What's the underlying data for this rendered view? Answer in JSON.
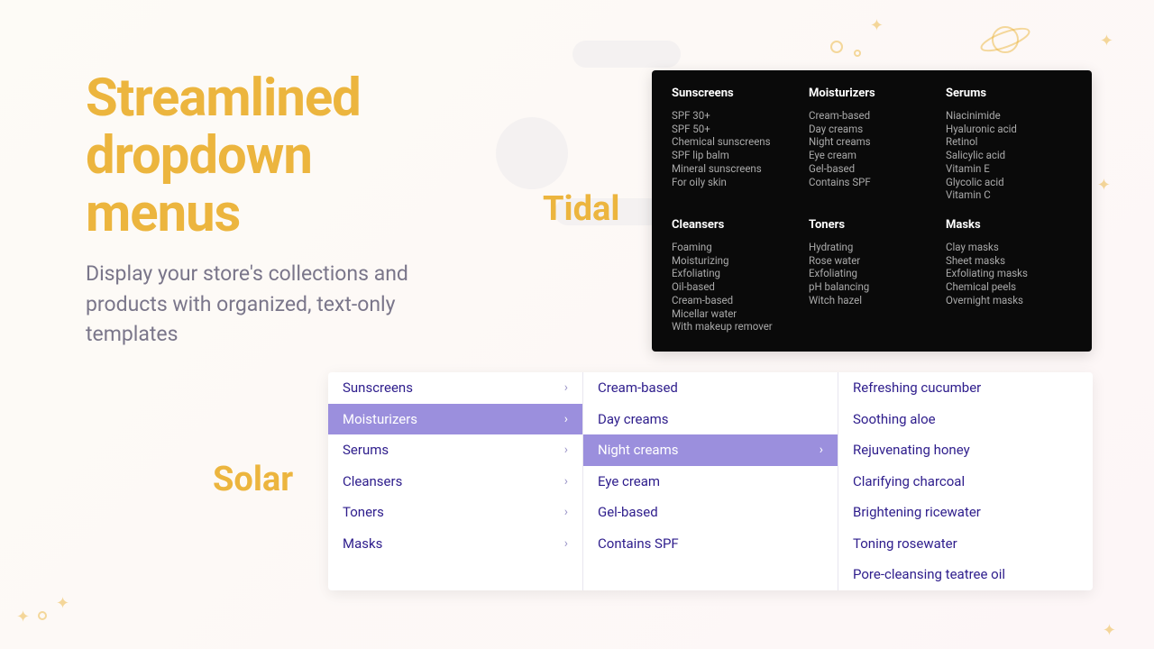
{
  "hero": {
    "title": "Streamlined dropdown menus",
    "subtitle": "Display your store's collections and products with organized, text-only templates"
  },
  "labels": {
    "tidal": "Tidal",
    "solar": "Solar"
  },
  "tidal": {
    "columns": [
      {
        "heading": "Sunscreens",
        "items": [
          "SPF 30+",
          "SPF 50+",
          "Chemical sunscreens",
          "SPF lip balm",
          "Mineral sunscreens",
          "For oily skin"
        ]
      },
      {
        "heading": "Moisturizers",
        "items": [
          "Cream-based",
          "Day creams",
          "Night creams",
          "Eye cream",
          "Gel-based",
          "Contains SPF"
        ]
      },
      {
        "heading": "Serums",
        "items": [
          "Niacinimide",
          "Hyaluronic acid",
          "Retinol",
          "Salicylic acid",
          "Vitamin E",
          "Glycolic acid",
          "Vitamin C"
        ]
      },
      {
        "heading": "Cleansers",
        "items": [
          "Foaming",
          "Moisturizing",
          "Exfoliating",
          "Oil-based",
          "Cream-based",
          "Micellar water",
          "With makeup remover"
        ]
      },
      {
        "heading": "Toners",
        "items": [
          "Hydrating",
          "Rose water",
          "Exfoliating",
          "pH balancing",
          "Witch hazel"
        ]
      },
      {
        "heading": "Masks",
        "items": [
          "Clay masks",
          "Sheet masks",
          "Exfoliating masks",
          "Chemical peels",
          "Overnight masks"
        ]
      }
    ]
  },
  "solar": {
    "col1": [
      {
        "label": "Sunscreens",
        "active": false
      },
      {
        "label": "Moisturizers",
        "active": true
      },
      {
        "label": "Serums",
        "active": false
      },
      {
        "label": "Cleansers",
        "active": false
      },
      {
        "label": "Toners",
        "active": false
      },
      {
        "label": "Masks",
        "active": false
      }
    ],
    "col2": [
      {
        "label": "Cream-based",
        "active": false
      },
      {
        "label": "Day creams",
        "active": false
      },
      {
        "label": "Night creams",
        "active": true
      },
      {
        "label": "Eye cream",
        "active": false
      },
      {
        "label": "Gel-based",
        "active": false
      },
      {
        "label": "Contains SPF",
        "active": false
      }
    ],
    "col3": [
      "Refreshing cucumber",
      "Soothing aloe",
      "Rejuvenating honey",
      "Clarifying charcoal",
      "Brightening ricewater",
      "Toning rosewater",
      "Pore-cleansing teatree oil"
    ]
  }
}
